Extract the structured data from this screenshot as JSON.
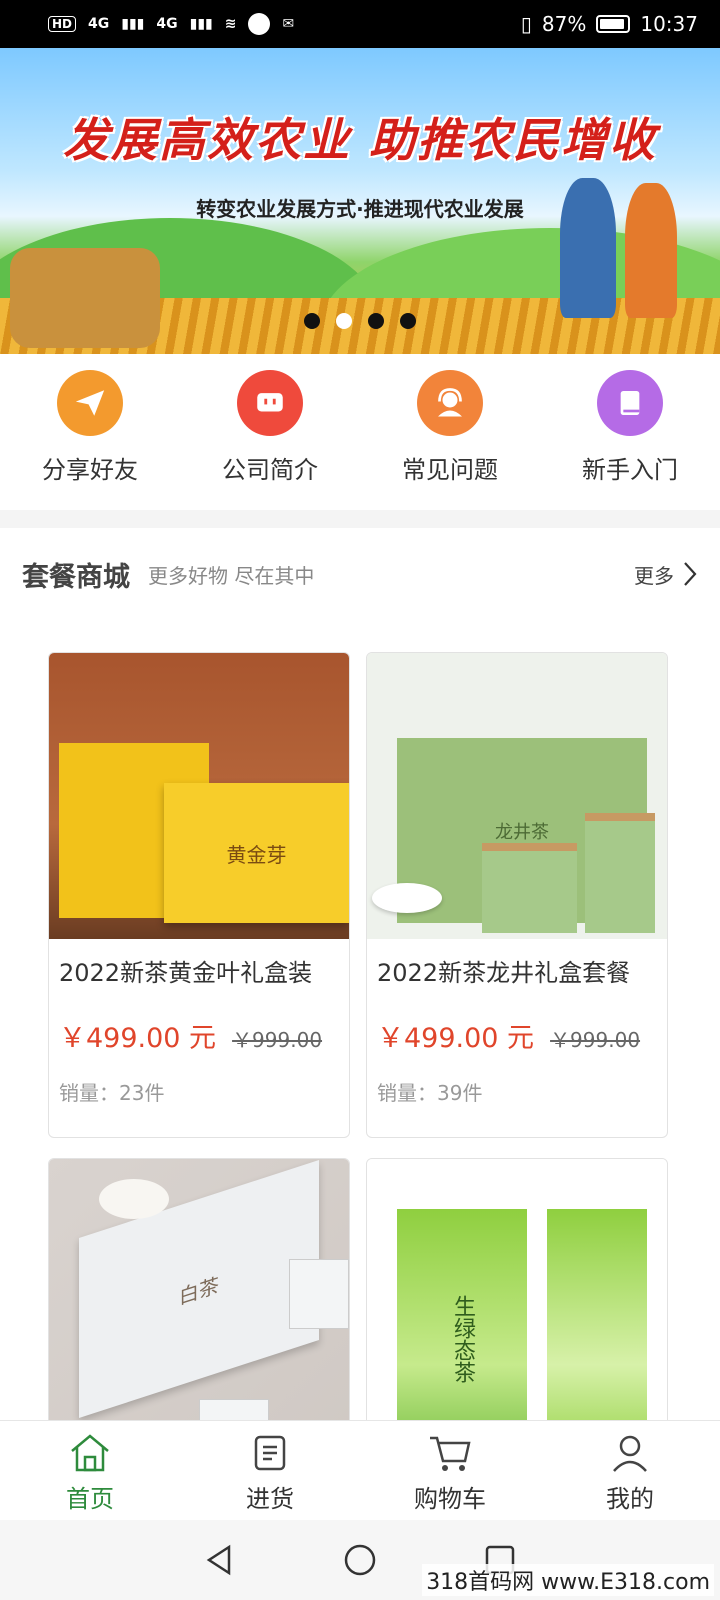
{
  "status_bar": {
    "hd": "HD",
    "signal1": "4G",
    "signal2": "4G",
    "battery_pct": "87%",
    "time": "10:37"
  },
  "banner": {
    "title": "发展高效农业  助推农民增收",
    "subtitle": "转变农业发展方式·推进现代农业发展",
    "slides": 4,
    "active_slide": 1
  },
  "quick_nav": [
    {
      "label": "分享好友",
      "icon": "paper-plane-icon",
      "color": "#f39a2e"
    },
    {
      "label": "公司简介",
      "icon": "tv-icon",
      "color": "#ef4a3c"
    },
    {
      "label": "常见问题",
      "icon": "headset-icon",
      "color": "#f2843a"
    },
    {
      "label": "新手入门",
      "icon": "book-icon",
      "color": "#b56be6"
    }
  ],
  "section": {
    "title": "套餐商城",
    "subtitle": "更多好物 尽在其中",
    "more": "更多"
  },
  "products": [
    {
      "name": "2022新茶黄金叶礼盒装",
      "price": "￥499.00 元",
      "old_price": "￥999.00",
      "sales": "销量：23件"
    },
    {
      "name": "2022新茶龙井礼盒套餐",
      "price": "￥499.00 元",
      "old_price": "￥999.00",
      "sales": "销量：39件"
    },
    {
      "name": "",
      "price": "",
      "old_price": "",
      "sales": ""
    },
    {
      "name": "",
      "price": "",
      "old_price": "",
      "sales": ""
    }
  ],
  "product_image_text": {
    "p1_box": "黄金芽",
    "p2_box": "龙井茶",
    "p3_box": "白茶",
    "p4_can": "生绿态茶"
  },
  "bottom_nav": [
    {
      "label": "首页",
      "icon": "home-icon",
      "active": true
    },
    {
      "label": "进货",
      "icon": "clipboard-icon",
      "active": false
    },
    {
      "label": "购物车",
      "icon": "cart-icon",
      "active": false
    },
    {
      "label": "我的",
      "icon": "user-icon",
      "active": false
    }
  ],
  "watermark": "318首码网  www.E318.com",
  "colors": {
    "accent_green": "#2e8b3c",
    "price_red": "#e0452b"
  }
}
